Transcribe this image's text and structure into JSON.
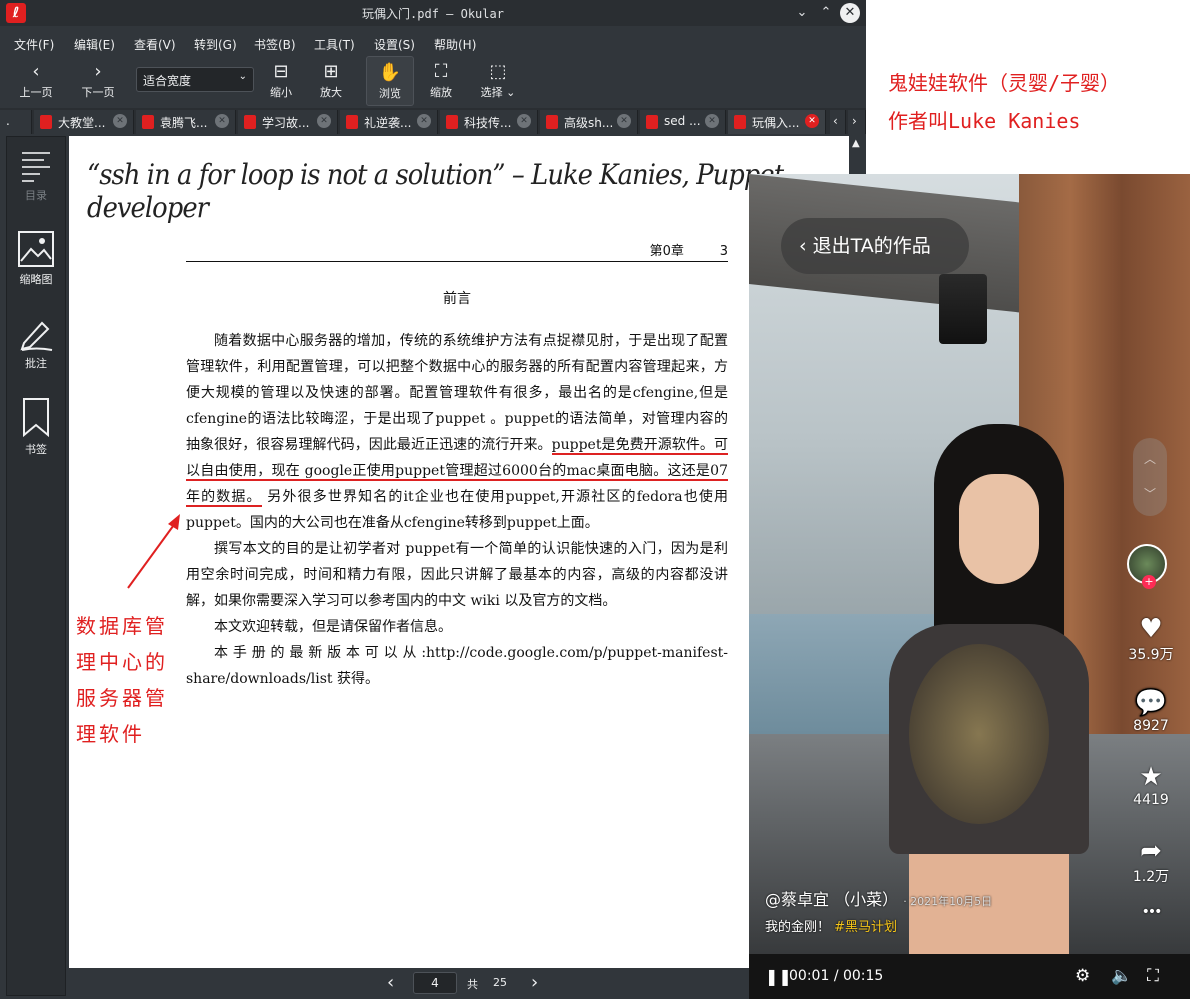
{
  "window": {
    "title": "玩偶入门.pdf — Okular",
    "app_icon": "okular-icon",
    "minimize_glyph": "⌄",
    "maximize_glyph": "⌃",
    "close_glyph": "✕"
  },
  "menu": [
    "文件(F)",
    "编辑(E)",
    "查看(V)",
    "转到(G)",
    "书签(B)",
    "工具(T)",
    "设置(S)",
    "帮助(H)"
  ],
  "toolbar": {
    "prev_label": "上一页",
    "next_label": "下一页",
    "zoom_value": "适合宽度",
    "zoom_out_label": "缩小",
    "zoom_in_label": "放大",
    "browse_label": "浏览",
    "zoom_label": "缩放",
    "select_label": "选择"
  },
  "tabs": [
    "大教堂...",
    "袁腾飞...",
    "学习故...",
    "礼逆袭...",
    "科技传...",
    "高级sh...",
    "sed ...",
    "玩偶入..."
  ],
  "sidebar": {
    "toc_label": "目录",
    "thumbnails_label": "缩略图",
    "annotations_label": "批注",
    "bookmarks_label": "书签"
  },
  "page": {
    "quote": "“ssh in a for loop is not a solution” – Luke Kanies, Puppet developer",
    "running_head": "第0章",
    "page_number_printed": "3",
    "chapter_title": "前言",
    "p1_a": "随着数据中心服务器的增加，传统的系统维护方法有点捉襟见肘，于是出现了配置管理软件，利用配置管理，可以把整个数据中心的服务器的所有配置内容管理起来，方便大规模的管理以及快速的部署。配置管理软件有很多，最出名的是cfengine,但是cfengine的语法比较晦涩，于是出现了puppet 。puppet的语法简单，对管理内容的抽象很好，很容易理解代码，因此最近正迅速的流行开来。",
    "p1_highlight": "puppet是免费开源软件。可以自由使用，现在 google正使用puppet管理超过6000台的mac桌面电脑。这还是07年的数据。",
    "p1_b": " 另外很多世界知名的it企业也在使用puppet,开源社区的fedora也使用puppet。国内的大公司也在准备从cfengine转移到puppet上面。",
    "p2": "撰写本文的目的是让初学者对 puppet有一个简单的认识能快速的入门，因为是利用空余时间完成，时间和精力有限，因此只讲解了最基本的内容，高级的内容都没讲解，如果你需要深入学习可以参考国内的中文 wiki 以及官方的文档。",
    "p3": "本文欢迎转载，但是请保留作者信息。",
    "p4": "本手册的最新版本可以从:http://code.google.com/p/puppet-manifest-share/downloads/list 获得。"
  },
  "annotation_left": "数据库管理中心的服务器管理软件",
  "navigation": {
    "current_page": "4",
    "total_prefix": "共",
    "total_pages": "25"
  },
  "note_right": {
    "line1": "鬼娃娃软件（灵婴/子婴）",
    "line2": "作者叫Luke Kanies"
  },
  "video": {
    "exit_button": "退出TA的作品",
    "likes": "35.9万",
    "comments": "8927",
    "favorites": "4419",
    "shares": "1.2万",
    "author": "@蔡卓宜 （小菜）",
    "date": "· 2021年10月5日",
    "description": "我的金刚！",
    "hashtag": "#黑马计划",
    "time_current": "00:01",
    "time_separator": "/",
    "time_total": "00:15",
    "more_glyph": "•••"
  },
  "colors": {
    "okular_bg": "#31363b",
    "annotation_red": "#e02020",
    "tiktok_plus": "#fe2c55",
    "hashtag": "#f5c518"
  }
}
